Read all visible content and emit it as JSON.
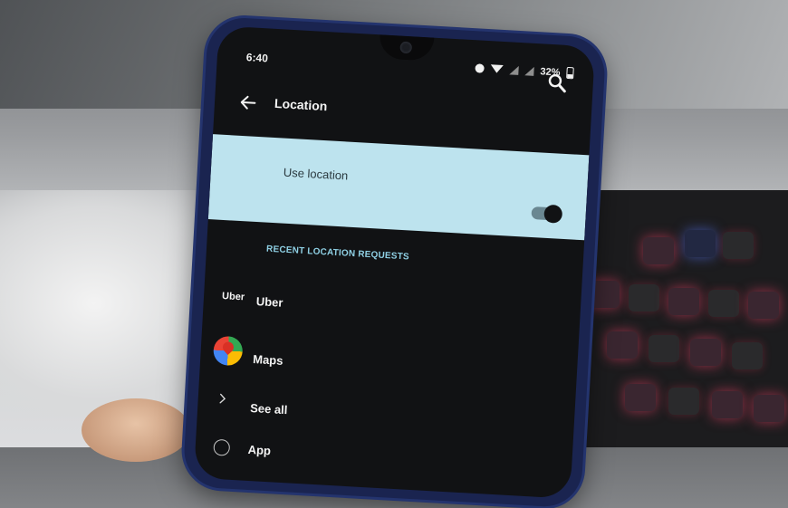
{
  "status_bar": {
    "time": "6:40",
    "battery": "32%"
  },
  "app_bar": {
    "title": "Location"
  },
  "use_location": {
    "label": "Use location",
    "enabled": true
  },
  "recent_requests": {
    "header": "RECENT LOCATION REQUESTS",
    "items": [
      {
        "icon_text": "Uber",
        "label": "Uber"
      },
      {
        "icon": "google-maps-icon",
        "label": "Maps"
      }
    ],
    "see_all_label": "See all",
    "next_item_partial": "App"
  },
  "colors": {
    "accent_row": "#bde3ee",
    "section_header": "#8fd0e4",
    "screen_bg": "#111214"
  }
}
